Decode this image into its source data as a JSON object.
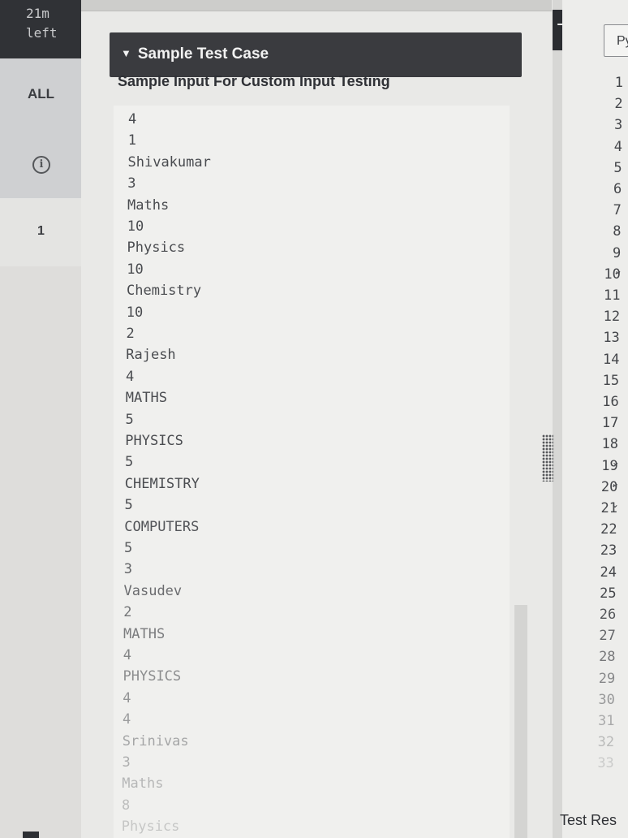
{
  "timer": {
    "line1": "21m",
    "line2": "left"
  },
  "rail": {
    "all_label": "ALL",
    "question_label": "1"
  },
  "sample": {
    "header": "Sample Test Case",
    "subtitle": "Sample Input For Custom Input Testing",
    "input_lines": [
      "4",
      "1",
      "Shivakumar",
      "3",
      "Maths",
      "10",
      "Physics",
      "10",
      "Chemistry",
      "10",
      "2",
      "Rajesh",
      "4",
      "MATHS",
      "5",
      "PHYSICS",
      "5",
      "CHEMISTRY",
      "5",
      "COMPUTERS",
      "5",
      "3",
      "Vasudev",
      "2",
      "MATHS",
      "4",
      "PHYSICS",
      "4",
      "4",
      "Srinivas",
      "3",
      "Maths",
      "8",
      "Physics"
    ]
  },
  "editor": {
    "language_label": "Py",
    "line_numbers": [
      "1",
      "2",
      "3",
      "4",
      "5",
      "6",
      "7",
      "8",
      "9",
      "10",
      "11",
      "12",
      "13",
      "14",
      "15",
      "16",
      "17",
      "18",
      "19",
      "20",
      "21",
      "22",
      "23",
      "24",
      "25",
      "26",
      "27",
      "28",
      "29",
      "30",
      "31",
      "32",
      "33"
    ],
    "folded_lines": [
      "10",
      "19",
      "20",
      "21"
    ]
  },
  "footer": {
    "test_results_label": "Test Res"
  }
}
